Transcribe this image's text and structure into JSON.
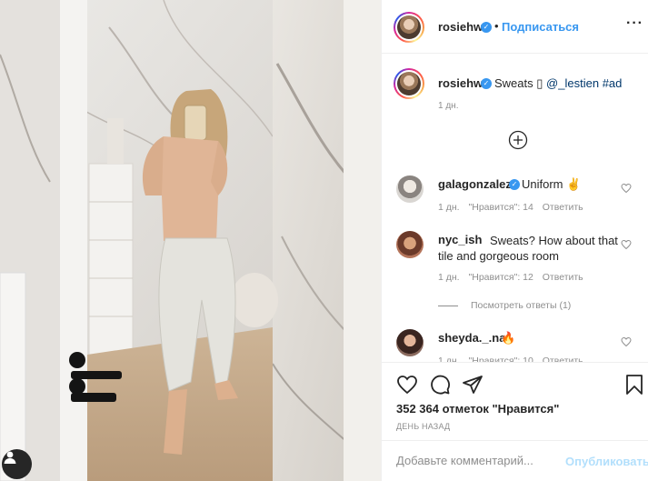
{
  "header": {
    "username": "rosiehw",
    "dot": "•",
    "follow_label": "Подписаться",
    "more_label": "···"
  },
  "caption": {
    "username": "rosiehw",
    "text": "Sweats",
    "emoji": "▯",
    "mention": "@_lestien",
    "hashtag": "#ad",
    "time": "1 дн."
  },
  "comments": [
    {
      "username": "galagonzalez",
      "verified": true,
      "text": "Uniform ✌",
      "time": "1 дн.",
      "likes": "\"Нравится\": 14",
      "reply": "Ответить"
    },
    {
      "username": "nyc_ish",
      "verified": false,
      "text": "Sweats? How about that tile and gorgeous room",
      "time": "1 дн.",
      "likes": "\"Нравится\": 12",
      "reply": "Ответить"
    },
    {
      "username": "sheyda._.na",
      "verified": false,
      "text": "🔥",
      "time": "1 дн.",
      "likes": "\"Нравится\": 10",
      "reply": "Ответить"
    }
  ],
  "view_replies": "Посмотреть ответы (1)",
  "actions": {
    "likes_text": "352 364 отметок \"Нравится\"",
    "time_ago": "ДЕНЬ НАЗАД"
  },
  "comment_box": {
    "placeholder": "Добавьте комментарий...",
    "publish_label": "Опубликовать"
  },
  "colors": {
    "accent": "#3897f0",
    "link": "#00376b",
    "muted": "#8e8e8e",
    "publish_disabled": "#b2dffc"
  },
  "icons": [
    "more-options-icon",
    "verified-icon",
    "load-more-icon",
    "heart-icon",
    "comment-icon",
    "share-icon",
    "bookmark-icon"
  ]
}
